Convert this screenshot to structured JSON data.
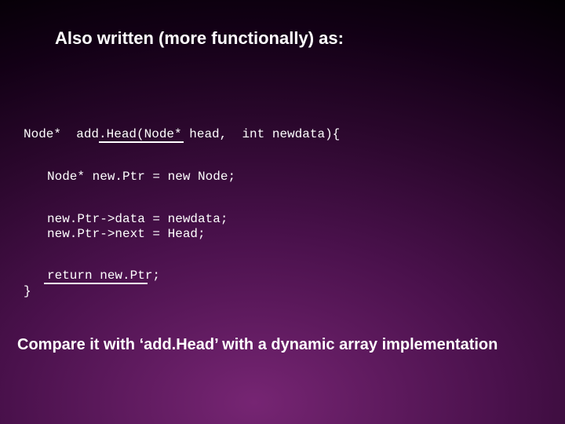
{
  "title": "Also written (more functionally) as:",
  "code": {
    "sig": "Node*  add.Head(Node* head,  int newdata){",
    "l2": "Node* new.Ptr = new Node;",
    "l3": "new.Ptr->data = newdata;",
    "l4": "new.Ptr->next = Head;",
    "l5": "return new.Ptr;",
    "close": "}"
  },
  "footer": "Compare it with ‘add.Head’ with a dynamic array implementation"
}
